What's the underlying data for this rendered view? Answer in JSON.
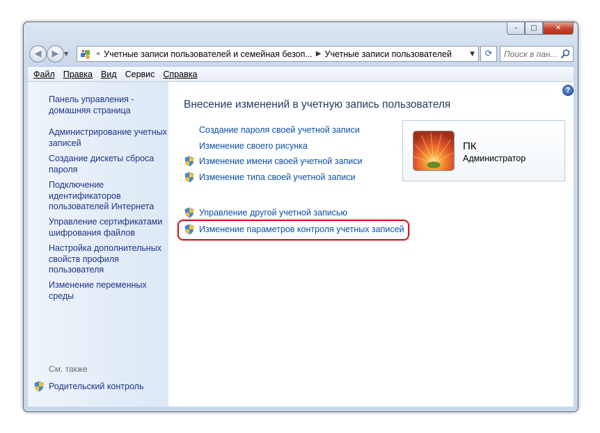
{
  "window": {
    "caption": {
      "minimize": "–",
      "maximize": "□",
      "close": "✕"
    }
  },
  "nav": {
    "back_icon": "back-arrow-icon",
    "forward_icon": "forward-arrow-icon",
    "breadcrumb_prefix": "«",
    "breadcrumb": [
      "Учетные записи пользователей и семейная безоп...",
      "Учетные записи пользователей"
    ],
    "dropdown": "▼",
    "refresh_glyph": "⟳",
    "search_placeholder": "Поиск в пан..."
  },
  "menu": {
    "file": "Файл",
    "edit": "Правка",
    "view": "Вид",
    "service": "Сервис",
    "help": "Справка"
  },
  "sidebar": {
    "home": "Панель управления - домашняя страница",
    "items": [
      "Администрирование учетных записей",
      "Создание дискеты сброса пароля",
      "Подключение идентификаторов пользователей Интернета",
      "Управление сертификатами шифрования файлов",
      "Настройка дополнительных свойств профиля пользователя",
      "Изменение переменных среды"
    ],
    "see_also": "См. также",
    "parental_control": "Родительский контроль"
  },
  "main": {
    "help_glyph": "?",
    "heading": "Внесение изменений в учетную запись пользователя",
    "tasks": [
      {
        "label": "Создание пароля своей учетной записи",
        "shield": false
      },
      {
        "label": "Изменение своего рисунка",
        "shield": false
      },
      {
        "label": "Изменение имени своей учетной записи",
        "shield": true
      },
      {
        "label": "Изменение типа своей учетной записи",
        "shield": true
      },
      {
        "label": "Управление другой учетной записью",
        "shield": true
      },
      {
        "label": "Изменение параметров контроля учетных записей",
        "shield": true,
        "highlighted": true
      }
    ],
    "user": {
      "name": "ПК",
      "role": "Администратор"
    }
  },
  "colors": {
    "link": "#0b4da8",
    "highlight_border": "#d4141c",
    "heading": "#1e395b"
  }
}
